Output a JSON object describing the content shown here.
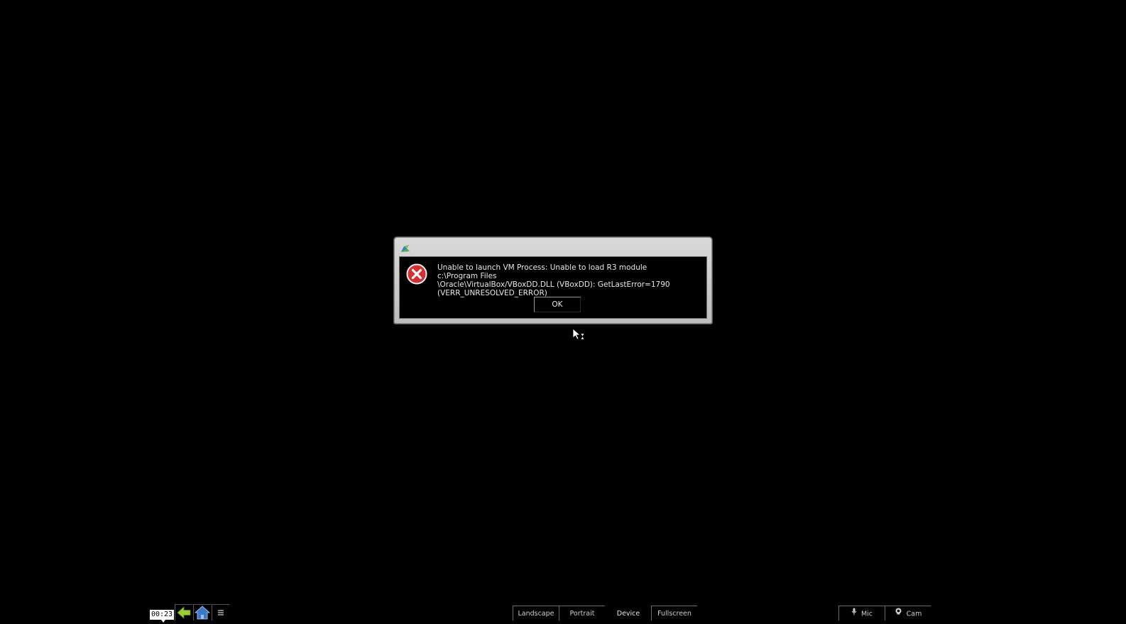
{
  "dialog": {
    "message": "Unable to launch VM Process: Unable to load R3 module c:\\Program Files\n\\Oracle\\VirtualBox/VBoxDD.DLL (VBoxDD): GetLastError=1790\n(VERR_UNRESOLVED_ERROR)",
    "ok_label": "OK",
    "icons": {
      "title": "virtualbox-app-icon",
      "error": "error-x-icon"
    }
  },
  "toolbar": {
    "timer": "00:23",
    "nav_icons": [
      "back-arrow-icon",
      "home-icon",
      "menu-icon"
    ],
    "view_buttons": [
      {
        "label": "Landscape"
      },
      {
        "label": "Portrait"
      },
      {
        "label": "Device"
      },
      {
        "label": "Fullscreen"
      }
    ],
    "media_buttons": [
      {
        "label": "Mic",
        "icon": "microphone-icon"
      },
      {
        "label": "Cam",
        "icon": "camera-icon"
      }
    ]
  },
  "colors": {
    "background": "#000000",
    "back_arrow": "#9acd32",
    "home": "#3a78c9",
    "error_red": "#d62f2f"
  }
}
